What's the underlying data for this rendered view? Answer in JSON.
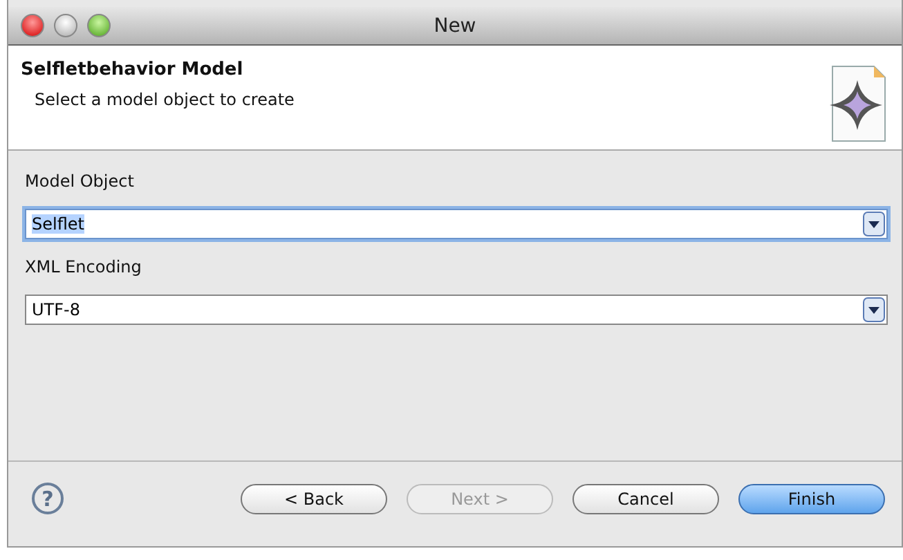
{
  "window": {
    "title": "New"
  },
  "header": {
    "title": "Selfletbehavior Model",
    "subtitle": "Select a model object to create"
  },
  "fields": [
    {
      "label": "Model Object",
      "value": "Selflet",
      "focused": true
    },
    {
      "label": "XML Encoding",
      "value": "UTF-8",
      "focused": false
    }
  ],
  "help": {
    "glyph": "?"
  },
  "buttons": [
    {
      "label": "< Back",
      "disabled": false,
      "default": false
    },
    {
      "label": "Next >",
      "disabled": true,
      "default": false
    },
    {
      "label": "Cancel",
      "disabled": false,
      "default": false
    },
    {
      "label": "Finish",
      "disabled": false,
      "default": true
    }
  ]
}
